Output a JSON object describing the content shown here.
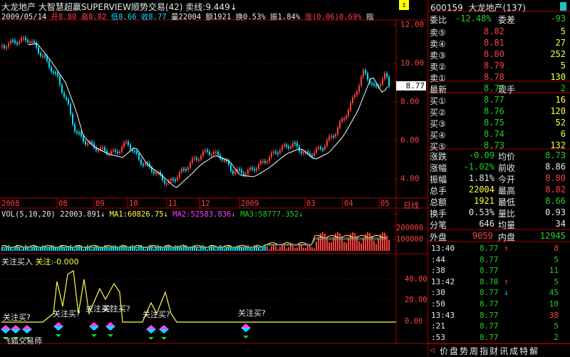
{
  "header": {
    "stock_name": "大龙地产",
    "formula_name": "大智慧超赢SUPERVIEW顺势交易(42)",
    "sell_line_label": "卖线:9.449",
    "sell_line_arrow": "↓",
    "date": "2009/05/14",
    "open": "开8.80",
    "high": "高8.82",
    "low": "低8.66",
    "close": "收8.77",
    "volume": "量22004",
    "amount": "额1921",
    "turnover": "换0.53%",
    "amplitude": "振1.84%",
    "change": "涨(0.06)0.69%",
    "index_label": "指"
  },
  "price_axis": [
    "12.00",
    "10.00",
    "8.00",
    "6.00",
    "4.00"
  ],
  "price_marker": "8.77",
  "time_axis": [
    "2008",
    "08",
    "09",
    "10",
    "11",
    "12",
    "2009",
    "03",
    "04",
    "05"
  ],
  "time_axis_unit": "日线",
  "vol_header": {
    "label": "VOL(5,10,20)",
    "vol": "22003.891",
    "ma1": "MA1:60826.75",
    "ma2": "MA2:52583.836",
    "ma3": "MA3:58777.352"
  },
  "vol_axis": [
    "200000",
    "100000"
  ],
  "indicator_header": {
    "label": "关注买入",
    "value": "关注:-0.000"
  },
  "indicator_axis": [
    "40.00",
    "20.00",
    "0.00"
  ],
  "signal_labels": [
    "关注买?",
    "关注买?",
    "关注买?",
    "关注买?",
    "关注买?",
    "关注买?"
  ],
  "bottom_label": "飞狐交易师",
  "quote": {
    "code": "600159",
    "name": "大龙地产",
    "count": "(137)",
    "weibi_label": "委比",
    "weibi_value": "-12.48%",
    "weicha_label": "委差",
    "weicha_value": "-93",
    "asks": [
      {
        "label": "卖⑤",
        "price": "8.82",
        "vol": "5"
      },
      {
        "label": "卖④",
        "price": "8.81",
        "vol": "27"
      },
      {
        "label": "卖③",
        "price": "8.80",
        "vol": "252"
      },
      {
        "label": "卖②",
        "price": "8.79",
        "vol": "5"
      },
      {
        "label": "卖①",
        "price": "8.78",
        "vol": "130"
      }
    ],
    "last_label": "最新",
    "last_price": "8.77",
    "current_label": "现手",
    "current_vol": "2",
    "bids": [
      {
        "label": "买①",
        "price": "8.77",
        "vol": "16"
      },
      {
        "label": "买②",
        "price": "8.76",
        "vol": "120"
      },
      {
        "label": "买③",
        "price": "8.75",
        "vol": "52"
      },
      {
        "label": "买④",
        "price": "8.74",
        "vol": "6"
      },
      {
        "label": "买⑤",
        "price": "8.73",
        "vol": "132"
      }
    ],
    "stats": [
      {
        "l1": "涨跌",
        "v1": "-0.09",
        "l2": "均价",
        "v2": "8.73"
      },
      {
        "l1": "涨幅",
        "v1": "-1.02%",
        "l2": "前收",
        "v2": "8.86"
      },
      {
        "l1": "振幅",
        "v1": "1.81%",
        "l2": "今开",
        "v2": "8.80"
      },
      {
        "l1": "总手",
        "v1": "22004",
        "l2": "最高",
        "v2": "8.82"
      },
      {
        "l1": "总额",
        "v1": "1921",
        "l2": "最低",
        "v2": "8.66"
      },
      {
        "l1": "换手",
        "v1": "0.53%",
        "l2": "量比",
        "v2": "0.93"
      },
      {
        "l1": "分笔",
        "v1": "646",
        "l2": "均量",
        "v2": "34"
      }
    ],
    "outer_label": "外盘",
    "outer_value": "9059",
    "inner_label": "内盘",
    "inner_value": "12945"
  },
  "ticks": [
    {
      "time": "13:40",
      "price": "8.77",
      "arrow": "↑",
      "vol": "8"
    },
    {
      "time": ":44",
      "price": "8.77",
      "arrow": "",
      "vol": "5"
    },
    {
      "time": ":38",
      "price": "8.77",
      "arrow": "",
      "vol": "11"
    },
    {
      "time": "13:42",
      "price": "8.78",
      "arrow": "↑",
      "vol": "5"
    },
    {
      "time": ":30",
      "price": "8.77",
      "arrow": "↓",
      "vol": "45"
    },
    {
      "time": ":50",
      "price": "8.77",
      "arrow": "",
      "vol": "10"
    },
    {
      "time": "13:43",
      "price": "8.77",
      "arrow": "",
      "vol": "38"
    },
    {
      "time": ":21",
      "price": "8.77",
      "arrow": "",
      "vol": "5"
    },
    {
      "time": ":53",
      "price": "8.77",
      "arrow": "",
      "vol": "2"
    }
  ],
  "tabs": [
    "价",
    "盘",
    "势",
    "周",
    "指",
    "财",
    "讯",
    "成",
    "特",
    "解"
  ],
  "colors": {
    "up": "#ff4040",
    "down": "#00e0ff",
    "border": "#aa0000",
    "ma": "#ffffff"
  }
}
